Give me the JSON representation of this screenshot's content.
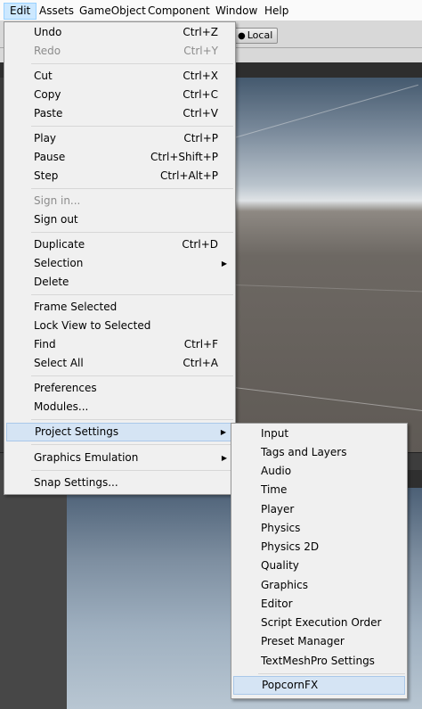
{
  "menubar": {
    "items": [
      "Edit",
      "Assets",
      "GameObject",
      "Component",
      "Window",
      "Help"
    ]
  },
  "toolbar": {
    "local_label": "Local"
  },
  "edit_menu": {
    "items": [
      {
        "label": "Undo",
        "shortcut": "Ctrl+Z"
      },
      {
        "label": "Redo",
        "shortcut": "Ctrl+Y"
      },
      {
        "label": "Cut",
        "shortcut": "Ctrl+X"
      },
      {
        "label": "Copy",
        "shortcut": "Ctrl+C"
      },
      {
        "label": "Paste",
        "shortcut": "Ctrl+V"
      },
      {
        "label": "Play",
        "shortcut": "Ctrl+P"
      },
      {
        "label": "Pause",
        "shortcut": "Ctrl+Shift+P"
      },
      {
        "label": "Step",
        "shortcut": "Ctrl+Alt+P"
      },
      {
        "label": "Sign in..."
      },
      {
        "label": "Sign out"
      },
      {
        "label": "Duplicate",
        "shortcut": "Ctrl+D"
      },
      {
        "label": "Selection"
      },
      {
        "label": "Delete"
      },
      {
        "label": "Frame Selected"
      },
      {
        "label": "Lock View to Selected"
      },
      {
        "label": "Find",
        "shortcut": "Ctrl+F"
      },
      {
        "label": "Select All",
        "shortcut": "Ctrl+A"
      },
      {
        "label": "Preferences"
      },
      {
        "label": "Modules..."
      },
      {
        "label": "Project Settings"
      },
      {
        "label": "Graphics Emulation"
      },
      {
        "label": "Snap Settings..."
      }
    ]
  },
  "project_settings_submenu": {
    "items": [
      "Input",
      "Tags and Layers",
      "Audio",
      "Time",
      "Player",
      "Physics",
      "Physics 2D",
      "Quality",
      "Graphics",
      "Editor",
      "Script Execution Order",
      "Preset Manager",
      "TextMeshPro Settings",
      "PopcornFX"
    ]
  },
  "colors": {
    "menu_bg": "#f0f0f0",
    "highlight": "#d5e4f4",
    "highlight_border": "#aac8e9",
    "disabled_text": "#8c8c8c",
    "menubar_active": "#cce8ff"
  },
  "icons": {
    "submenu_arrow": "triangle-right-icon",
    "local_button": "globe-icon"
  }
}
